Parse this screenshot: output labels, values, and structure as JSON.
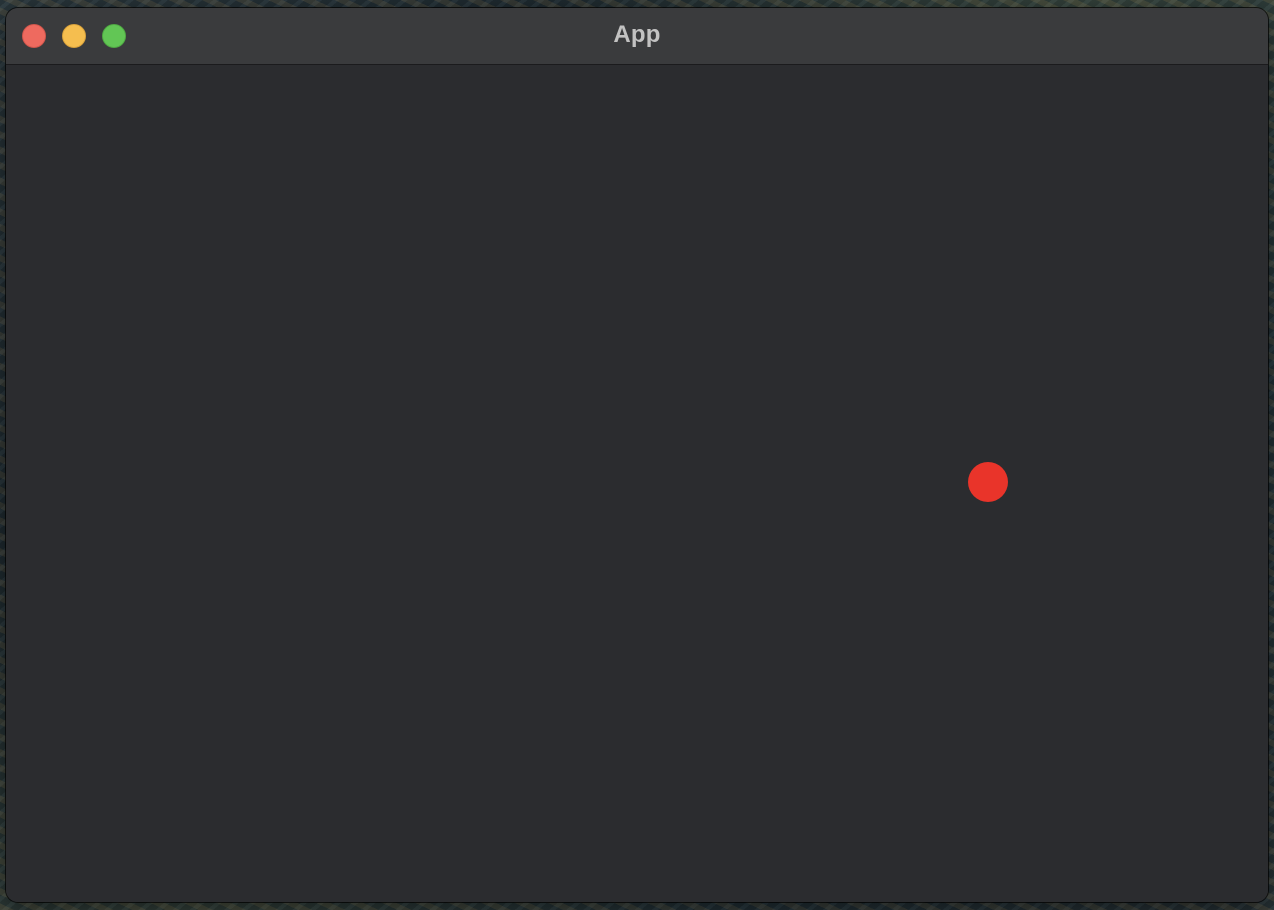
{
  "window": {
    "title": "App"
  },
  "traffic_lights": [
    {
      "name": "close",
      "color": "#ee6a5f"
    },
    {
      "name": "minimize",
      "color": "#f5be4f"
    },
    {
      "name": "zoom",
      "color": "#62c655"
    }
  ],
  "content": {
    "background_color": "#2b2c2f",
    "dot_color": "#e9342a"
  }
}
